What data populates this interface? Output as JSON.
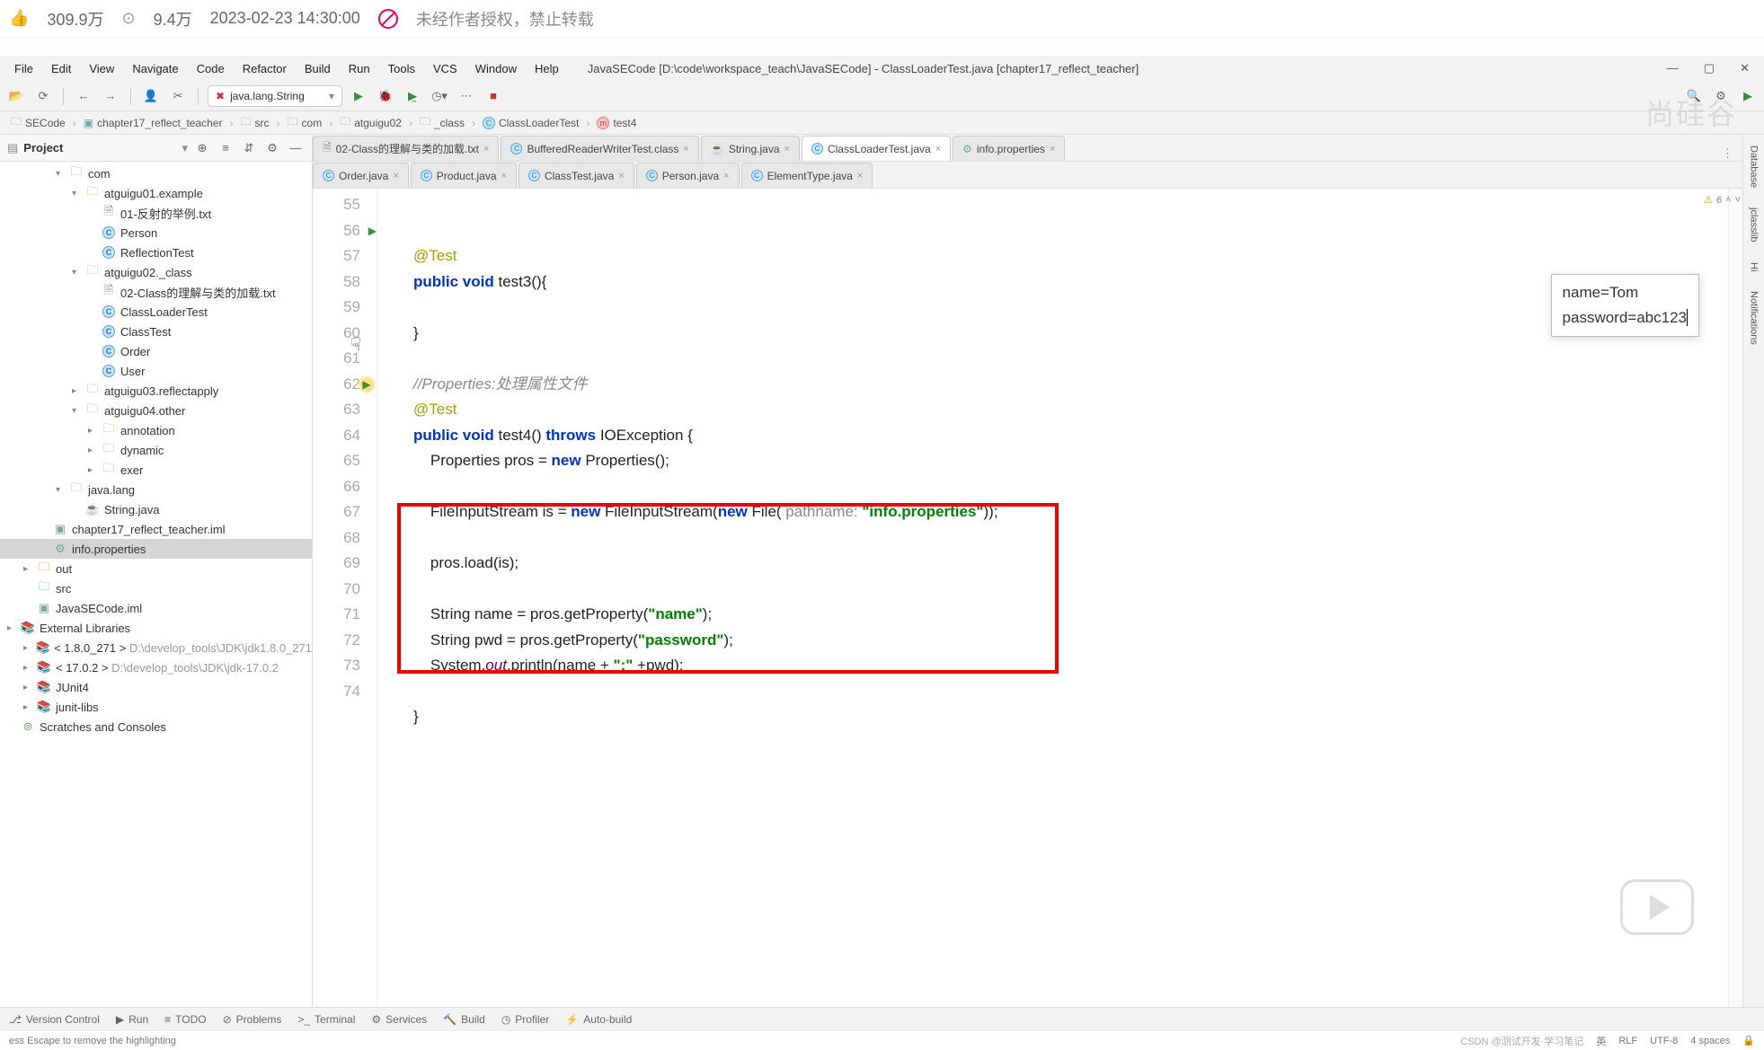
{
  "video_bar": {
    "likes": "309.9万",
    "coins": "9.4万",
    "timestamp": "2023-02-23 14:30:00",
    "no_copy": "未经作者授权，禁止转载"
  },
  "menu": {
    "items": [
      "File",
      "Edit",
      "View",
      "Navigate",
      "Code",
      "Refactor",
      "Build",
      "Run",
      "Tools",
      "VCS",
      "Window",
      "Help"
    ],
    "window_path": "JavaSECode [D:\\code\\workspace_teach\\JavaSECode] - ClassLoaderTest.java [chapter17_reflect_teacher]"
  },
  "toolbar": {
    "run_config": "java.lang.String"
  },
  "breadcrumb": {
    "items": [
      {
        "label": "SECode",
        "icon": "folder"
      },
      {
        "label": "chapter17_reflect_teacher",
        "icon": "module"
      },
      {
        "label": "src",
        "icon": "folder"
      },
      {
        "label": "com",
        "icon": "folder"
      },
      {
        "label": "atguigu02",
        "icon": "folder"
      },
      {
        "label": "_class",
        "icon": "folder"
      },
      {
        "label": "ClassLoaderTest",
        "icon": "class"
      },
      {
        "label": "test4",
        "icon": "method"
      }
    ]
  },
  "project": {
    "title": "Project",
    "tree": [
      {
        "indent": 3,
        "arrow": "▾",
        "icon": "dir",
        "label": "com"
      },
      {
        "indent": 4,
        "arrow": "▾",
        "icon": "dir",
        "label": "atguigu01.example"
      },
      {
        "indent": 5,
        "arrow": "",
        "icon": "txt",
        "label": "01-反射的举例.txt"
      },
      {
        "indent": 5,
        "arrow": "",
        "icon": "class",
        "label": "Person"
      },
      {
        "indent": 5,
        "arrow": "",
        "icon": "class",
        "label": "ReflectionTest"
      },
      {
        "indent": 4,
        "arrow": "▾",
        "icon": "dir",
        "label": "atguigu02._class"
      },
      {
        "indent": 5,
        "arrow": "",
        "icon": "txt",
        "label": "02-Class的理解与类的加载.txt"
      },
      {
        "indent": 5,
        "arrow": "",
        "icon": "class",
        "label": "ClassLoaderTest"
      },
      {
        "indent": 5,
        "arrow": "",
        "icon": "class",
        "label": "ClassTest"
      },
      {
        "indent": 5,
        "arrow": "",
        "icon": "class",
        "label": "Order"
      },
      {
        "indent": 5,
        "arrow": "",
        "icon": "class",
        "label": "User"
      },
      {
        "indent": 4,
        "arrow": "▸",
        "icon": "dir",
        "label": "atguigu03.reflectapply"
      },
      {
        "indent": 4,
        "arrow": "▾",
        "icon": "dir",
        "label": "atguigu04.other"
      },
      {
        "indent": 5,
        "arrow": "▸",
        "icon": "dir",
        "label": "annotation"
      },
      {
        "indent": 5,
        "arrow": "▸",
        "icon": "dir",
        "label": "dynamic"
      },
      {
        "indent": 5,
        "arrow": "▸",
        "icon": "dir",
        "label": "exer"
      },
      {
        "indent": 3,
        "arrow": "▾",
        "icon": "dir",
        "label": "java.lang"
      },
      {
        "indent": 4,
        "arrow": "",
        "icon": "java",
        "label": "String.java"
      },
      {
        "indent": 2,
        "arrow": "",
        "icon": "iml",
        "label": "chapter17_reflect_teacher.iml"
      },
      {
        "indent": 2,
        "arrow": "",
        "icon": "prop",
        "label": "info.properties",
        "sel": true
      },
      {
        "indent": 1,
        "arrow": "▸",
        "icon": "out",
        "label": "out"
      },
      {
        "indent": 1,
        "arrow": "",
        "icon": "src",
        "label": "src"
      },
      {
        "indent": 1,
        "arrow": "",
        "icon": "iml",
        "label": "JavaSECode.iml"
      },
      {
        "indent": 0,
        "arrow": "▸",
        "icon": "lib",
        "label": "External Libraries"
      },
      {
        "indent": 1,
        "arrow": "▸",
        "icon": "lib",
        "label": "< 1.8.0_271 >",
        "muted": "D:\\develop_tools\\JDK\\jdk1.8.0_271"
      },
      {
        "indent": 1,
        "arrow": "▸",
        "icon": "lib",
        "label": "< 17.0.2 >",
        "muted": "D:\\develop_tools\\JDK\\jdk-17.0.2"
      },
      {
        "indent": 1,
        "arrow": "▸",
        "icon": "lib",
        "label": "JUnit4"
      },
      {
        "indent": 1,
        "arrow": "▸",
        "icon": "lib",
        "label": "junit-libs"
      },
      {
        "indent": 0,
        "arrow": "",
        "icon": "scratch",
        "label": "Scratches and Consoles"
      }
    ]
  },
  "tabs": {
    "row1": [
      {
        "label": "02-Class的理解与类的加载.txt",
        "icon": "txt"
      },
      {
        "label": "BufferedReaderWriterTest.class",
        "icon": "class"
      },
      {
        "label": "String.java",
        "icon": "java"
      },
      {
        "label": "ClassLoaderTest.java",
        "icon": "class",
        "active": true
      },
      {
        "label": "info.properties",
        "icon": "prop"
      }
    ],
    "row2": [
      {
        "label": "Order.java",
        "icon": "class"
      },
      {
        "label": "Product.java",
        "icon": "class"
      },
      {
        "label": "ClassTest.java",
        "icon": "class"
      },
      {
        "label": "Person.java",
        "icon": "class"
      },
      {
        "label": "ElementType.java",
        "icon": "class"
      }
    ]
  },
  "gutter": {
    "start": 55,
    "end": 74,
    "run_lines": [
      56
    ],
    "hilite_line": 62
  },
  "code": {
    "lines": [
      {
        "n": 55,
        "html": "<span class='anno'>@Test</span>"
      },
      {
        "n": 56,
        "html": "<span class='kw'>public</span> <span class='kw'>void</span> test3(){"
      },
      {
        "n": 57,
        "html": ""
      },
      {
        "n": 58,
        "html": "}"
      },
      {
        "n": 59,
        "html": ""
      },
      {
        "n": 60,
        "html": "<span class='cmt'>//Properties:处理属性文件</span>"
      },
      {
        "n": 61,
        "html": "<span class='anno'>@Test</span>"
      },
      {
        "n": 62,
        "html": "<span class='kw'>public</span> <span class='kw'>void</span> test4() <span class='kw'>throws</span> IOException {"
      },
      {
        "n": 63,
        "html": "    Properties pros = <span class='kw'>new</span> Properties();"
      },
      {
        "n": 64,
        "html": ""
      },
      {
        "n": 65,
        "html": "    FileInputStream is = <span class='kw'>new</span> FileInputStream(<span class='kw'>new</span> File( <span class='param'>pathname:</span> <span class='str'>\"info.properties\"</span>));"
      },
      {
        "n": 66,
        "html": ""
      },
      {
        "n": 67,
        "html": "    pros.load(is);"
      },
      {
        "n": 68,
        "html": ""
      },
      {
        "n": 69,
        "html": "    String name = pros.getProperty(<span class='str'>\"name\"</span>);"
      },
      {
        "n": 70,
        "html": "    String pwd = pros.getProperty(<span class='str'>\"password\"</span>);"
      },
      {
        "n": 71,
        "html": "    System.<span class='field'>out</span>.println(name + <span class='str'>\":\"</span> +pwd);"
      },
      {
        "n": 72,
        "html": ""
      },
      {
        "n": 73,
        "html": "}"
      },
      {
        "n": 74,
        "html": ""
      }
    ]
  },
  "popup": {
    "line1": "name=Tom",
    "line2": "password=abc123"
  },
  "warnings": {
    "count": "6"
  },
  "right_tabs": [
    "Database",
    "jclasslib",
    "Hi",
    "Notifications"
  ],
  "bottom": {
    "items": [
      {
        "icon": "⎇",
        "label": "Version Control"
      },
      {
        "icon": "▶",
        "label": "Run"
      },
      {
        "icon": "≡",
        "label": "TODO"
      },
      {
        "icon": "⊘",
        "label": "Problems"
      },
      {
        "icon": ">_",
        "label": "Terminal"
      },
      {
        "icon": "⚙",
        "label": "Services"
      },
      {
        "icon": "🔨",
        "label": "Build"
      },
      {
        "icon": "◷",
        "label": "Profiler"
      },
      {
        "icon": "⚡",
        "label": "Auto-build"
      }
    ]
  },
  "status": {
    "left": "ess Escape to remove the highlighting",
    "right": [
      "英",
      "RLF",
      "UTF-8",
      "4 spaces",
      "🔒"
    ],
    "csdn": "CSDN @测试开发·学习笔记"
  },
  "watermark": "尚硅谷"
}
